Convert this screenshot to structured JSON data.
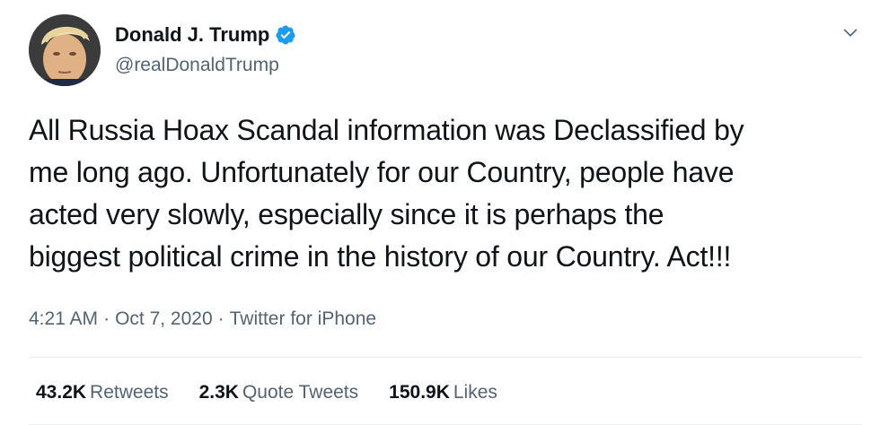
{
  "author": {
    "display_name": "Donald J. Trump",
    "handle": "@realDonaldTrump",
    "verified": true
  },
  "tweet": {
    "line1": "All Russia Hoax Scandal information was Declassified by",
    "line2": "me long ago. Unfortunately for our Country, people have",
    "line3": "acted very slowly, especially since it is perhaps the",
    "line4": "biggest political crime in the history of our Country. Act!!!",
    "time": "4:21 AM",
    "date": "Oct 7, 2020",
    "separator": "·",
    "source": "Twitter for iPhone"
  },
  "stats": {
    "retweets_count": "43.2K",
    "retweets_label": "Retweets",
    "quotes_count": "2.3K",
    "quotes_label": "Quote Tweets",
    "likes_count": "150.9K",
    "likes_label": "Likes"
  },
  "icons": {
    "verified": "verified-badge-icon",
    "caret": "chevron-down-icon"
  },
  "colors": {
    "verified_blue": "#1d9bf0",
    "secondary_text": "#536471",
    "primary_text": "#0f1419"
  }
}
